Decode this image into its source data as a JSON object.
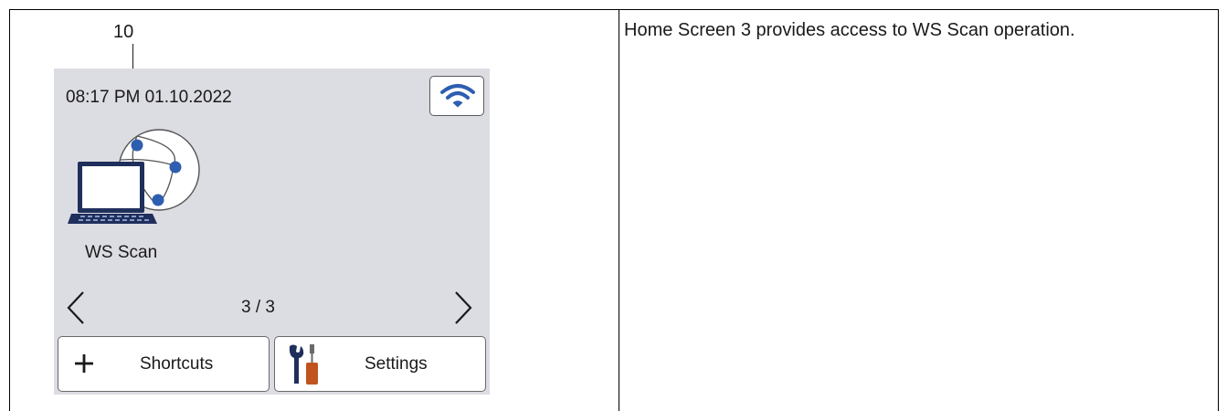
{
  "callout": {
    "number": "10"
  },
  "lcd": {
    "datetime": "08:17 PM 01.10.2022",
    "wifi_icon": "wifi-icon",
    "tile": {
      "label": "WS Scan",
      "icon": "ws-scan-icon"
    },
    "pagination": {
      "text": "3 / 3",
      "prev_icon": "chevron-left-icon",
      "next_icon": "chevron-right-icon"
    },
    "buttons": {
      "shortcuts": {
        "label": "Shortcuts",
        "icon": "plus-icon"
      },
      "settings": {
        "label": "Settings",
        "icon": "tools-icon"
      }
    }
  },
  "description": "Home Screen 3 provides access to WS Scan operation.",
  "colors": {
    "lcd_background": "#dcdce3",
    "accent_blue": "#2d5eb0",
    "laptop_navy": "#1f2f5c",
    "tool_orange": "#c0531f"
  }
}
